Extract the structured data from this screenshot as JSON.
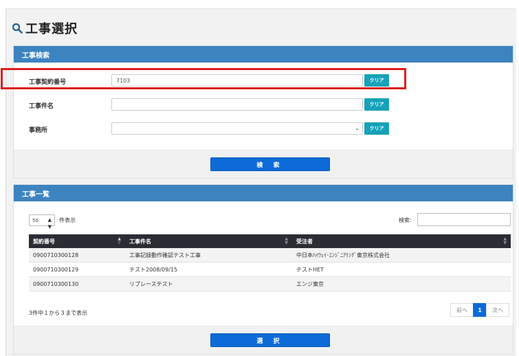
{
  "header": {
    "title": "工事選択",
    "icon": "search-icon"
  },
  "search_panel": {
    "heading": "工事検索",
    "fields": [
      {
        "label": "工事契約番号",
        "value": "7103",
        "clear_label": "クリア"
      },
      {
        "label": "工事件名",
        "value": "",
        "clear_label": "クリア"
      },
      {
        "label": "事務所",
        "value": "",
        "clear_label": "クリア"
      }
    ],
    "search_button": "検 索"
  },
  "list_panel": {
    "heading": "工事一覧",
    "page_length": "50",
    "page_length_suffix": "件表示",
    "search_label": "検索:",
    "search_value": "",
    "columns": [
      "契約番号",
      "工事件名",
      "受注者"
    ],
    "rows": [
      [
        "0900710300128",
        "工事記録動作確認テスト工事",
        "中日本ﾊｲｳｪｲ･ｴﾝｼﾞﾆｱﾘﾝｸﾞ東京株式会社"
      ],
      [
        "0900710300129",
        "テスト2008/09/15",
        "テストHET"
      ],
      [
        "0900710300130",
        "リプレーステスト",
        "エンジ東京"
      ]
    ],
    "info": "3件中１から３まで表示",
    "pagination": {
      "prev": "前へ",
      "current": "1",
      "next": "次へ"
    },
    "select_button": "選 択"
  },
  "colors": {
    "panel_header": "#3c83c0",
    "primary_button": "#0c6bd8",
    "clear_button": "#17a2b8",
    "table_header": "#2a2e34",
    "highlight": "#e01b1b"
  }
}
